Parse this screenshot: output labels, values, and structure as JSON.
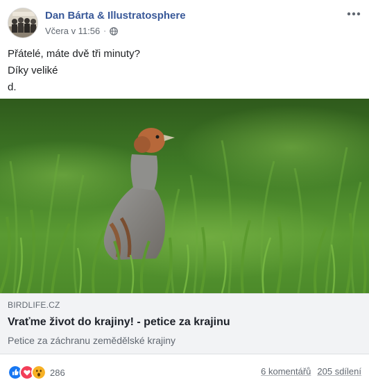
{
  "post": {
    "author": "Dan Bárta & Illustratosphere",
    "timestamp": "Včera v 11:56",
    "separator": "·",
    "privacy_icon": "globe-icon",
    "text_lines": [
      "Přátelé, máte dvě tři minuty?",
      "Díky veliké",
      "d."
    ]
  },
  "link": {
    "domain": "BIRDLIFE.CZ",
    "title": "Vraťme život do krajiny! - petice za krajinu",
    "description": "Petice za záchranu zemědělské krajiny"
  },
  "footer": {
    "reactions": [
      "like-reaction-icon",
      "love-reaction-icon",
      "wow-reaction-icon"
    ],
    "reaction_count": "286",
    "comments": "6 komentářů",
    "shares": "205 sdílení"
  },
  "colors": {
    "author_link": "#385898",
    "secondary_text": "#606770",
    "card_background": "#f2f3f5",
    "like_blue": "#1877f2",
    "love_red": "#f33e58",
    "wow_yellow": "#f7b125"
  }
}
